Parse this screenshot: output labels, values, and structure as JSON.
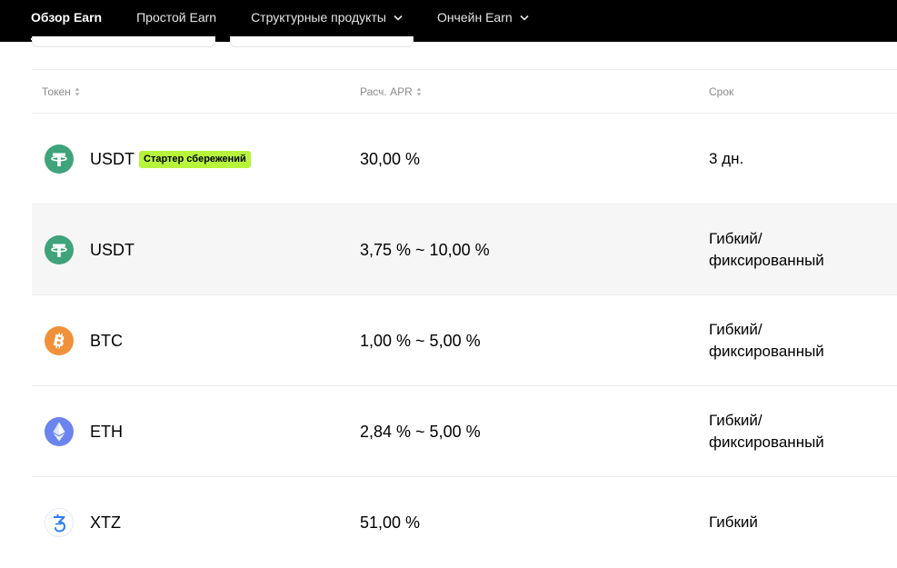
{
  "nav": {
    "tabs": [
      {
        "label": "Обзор Earn",
        "active": true,
        "dropdown": false
      },
      {
        "label": "Простой Earn",
        "active": false,
        "dropdown": false
      },
      {
        "label": "Структурные продукты",
        "active": false,
        "dropdown": true
      },
      {
        "label": "Ончейн Earn",
        "active": false,
        "dropdown": true
      }
    ]
  },
  "table": {
    "headers": {
      "token": "Токен",
      "apr": "Расч. APR",
      "term": "Срок"
    },
    "rows": [
      {
        "token": "USDT",
        "icon": "usdt-icon",
        "badge": "Стартер сбережений",
        "apr": "30,00 %",
        "term_line1": "3 дн.",
        "term_line2": ""
      },
      {
        "token": "USDT",
        "icon": "usdt-icon",
        "badge": "",
        "apr": "3,75 % ~ 10,00 %",
        "term_line1": "Гибкий/",
        "term_line2": "фиксированный"
      },
      {
        "token": "BTC",
        "icon": "btc-icon",
        "badge": "",
        "apr": "1,00 % ~ 5,00 %",
        "term_line1": "Гибкий/",
        "term_line2": "фиксированный"
      },
      {
        "token": "ETH",
        "icon": "eth-icon",
        "badge": "",
        "apr": "2,84 % ~ 5,00 %",
        "term_line1": "Гибкий/",
        "term_line2": "фиксированный"
      },
      {
        "token": "XTZ",
        "icon": "xtz-icon",
        "badge": "",
        "apr": "51,00 %",
        "term_line1": "Гибкий",
        "term_line2": ""
      }
    ]
  },
  "colors": {
    "usdt": "#3fa37c",
    "btc": "#f0913a",
    "eth": "#6b84ee",
    "xtz": "#2c7df7",
    "badge": "#b6f53a"
  }
}
